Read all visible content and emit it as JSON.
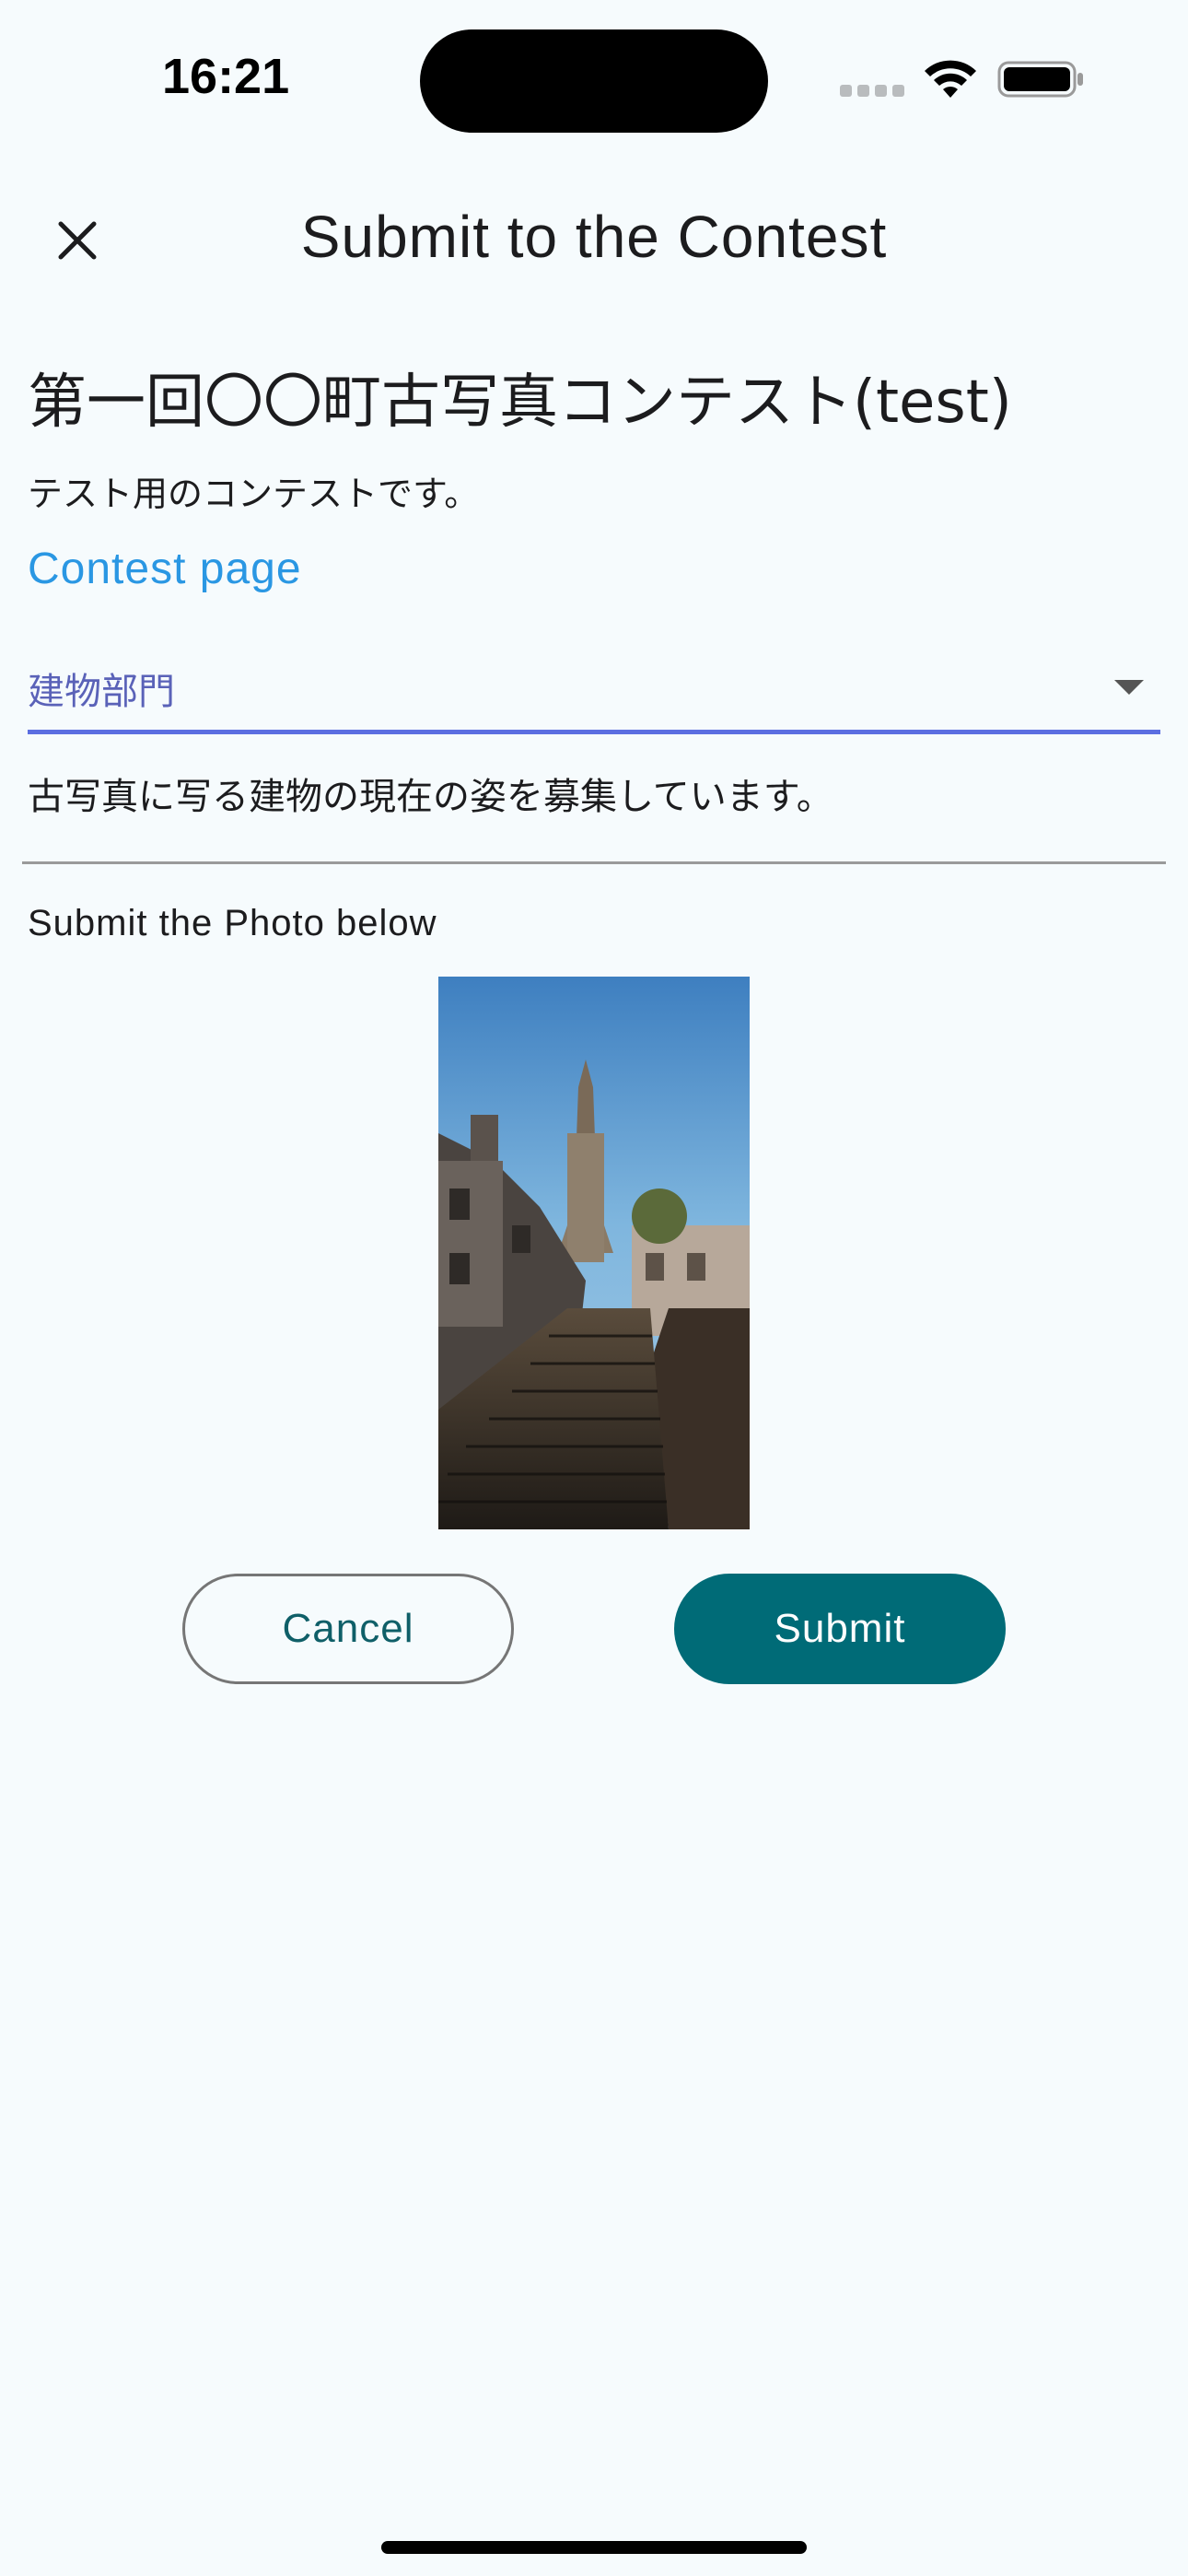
{
  "status_bar": {
    "time": "16:21",
    "icons": [
      "signal-dots-icon",
      "wifi-icon",
      "battery-icon"
    ]
  },
  "app_bar": {
    "close_icon": "close-icon",
    "title": "Submit to the Contest"
  },
  "contest": {
    "title": "第一回〇〇町古写真コンテスト(test)",
    "description": "テスト用のコンテストです。",
    "link_label": "Contest page"
  },
  "category": {
    "selected": "建物部門",
    "description": "古写真に写る建物の現在の姿を募集しています。"
  },
  "photo": {
    "label": "Submit the Photo below"
  },
  "actions": {
    "cancel_label": "Cancel",
    "submit_label": "Submit"
  },
  "colors": {
    "accent": "#006b77",
    "link": "#2a97e3",
    "select_underline": "#5b6ee1",
    "background": "#f6fbfd"
  }
}
